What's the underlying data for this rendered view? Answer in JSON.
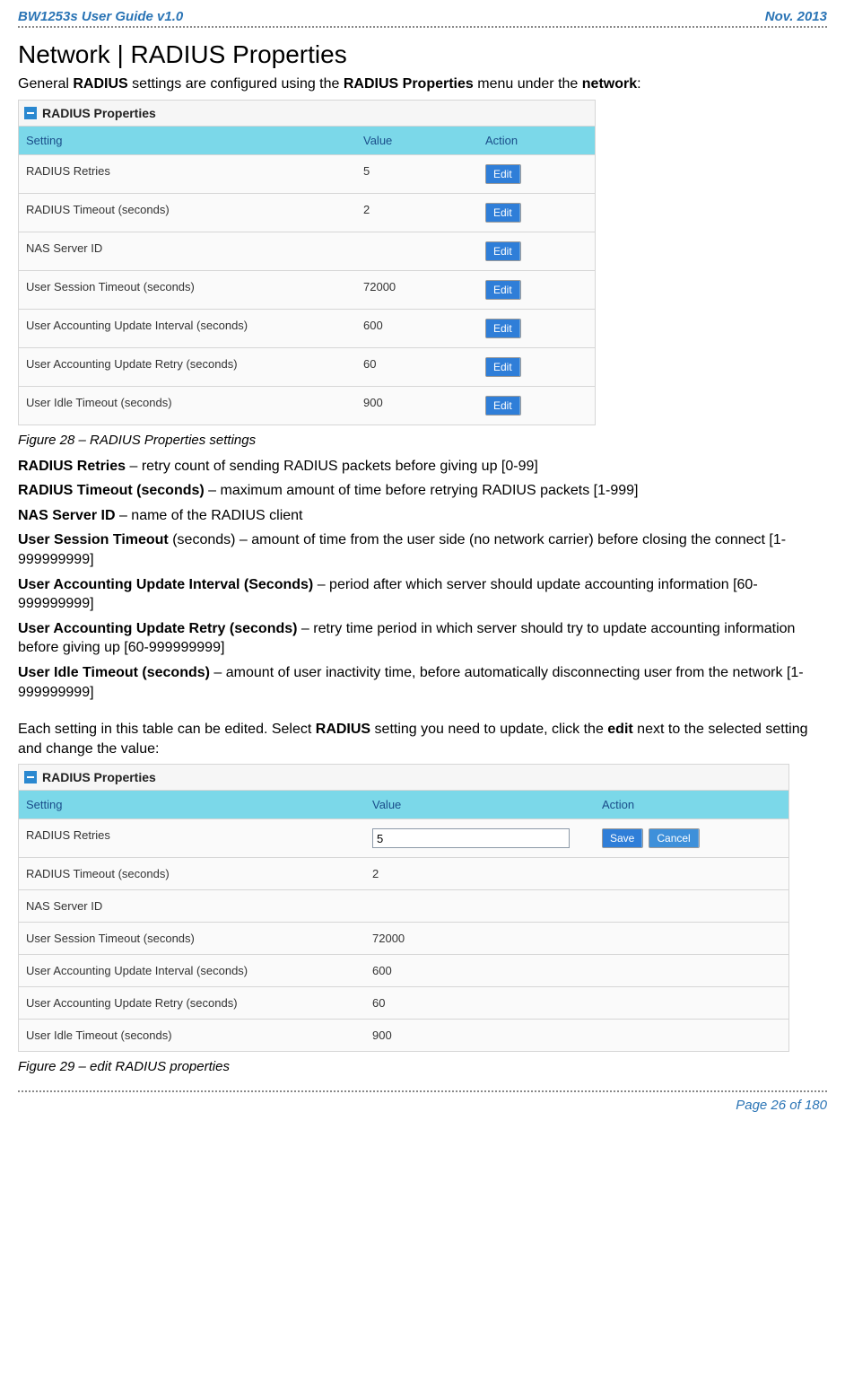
{
  "header": {
    "left": "BW1253s User Guide v1.0",
    "right": "Nov.  2013"
  },
  "title": "Network | RADIUS Properties",
  "intro": {
    "pre": "General ",
    "b1": "RADIUS",
    "mid": " settings are configured using the ",
    "b2": "RADIUS Properties",
    "mid2": " menu under the ",
    "b3": "network",
    "post": ":"
  },
  "panel_title": "RADIUS Properties",
  "columns": {
    "setting": "Setting",
    "value": "Value",
    "action": "Action"
  },
  "rows1": [
    {
      "setting": "RADIUS Retries",
      "value": "5"
    },
    {
      "setting": "RADIUS Timeout (seconds)",
      "value": "2"
    },
    {
      "setting": "NAS Server ID",
      "value": ""
    },
    {
      "setting": "User Session Timeout (seconds)",
      "value": "72000"
    },
    {
      "setting": "User Accounting Update Interval (seconds)",
      "value": "600"
    },
    {
      "setting": "User Accounting Update Retry (seconds)",
      "value": "60"
    },
    {
      "setting": "User Idle Timeout (seconds)",
      "value": "900"
    }
  ],
  "btn_edit": "Edit",
  "btn_save": "Save",
  "btn_cancel": "Cancel",
  "fig28": "Figure 28 – RADIUS Properties settings",
  "defs": [
    {
      "b": "RADIUS Retries",
      "t": " – retry count of sending RADIUS packets before giving up [0-99]"
    },
    {
      "b": "RADIUS Timeout (seconds)",
      "t": " – maximum amount of time before retrying RADIUS packets [1-999]"
    },
    {
      "b": "NAS Server ID",
      "t": " – name of the RADIUS client"
    },
    {
      "b": "User Session Timeout",
      "t": " (seconds) – amount of time from the user side (no network carrier) before closing the connect [1-999999999]"
    },
    {
      "b": "User Accounting Update Interval (Seconds)",
      "t": " – period after which server should update accounting information [60-999999999]"
    },
    {
      "b": "User Accounting Update Retry (seconds)",
      "t": " – retry time period in which server should try to update accounting information before giving up [60-999999999]"
    },
    {
      "b": "User Idle Timeout (seconds)",
      "t": " – amount of user inactivity time, before automatically disconnecting user from the network [1-999999999]"
    }
  ],
  "para_each": {
    "p1": "Each setting in this table can be edited. Select ",
    "b1": "RADIUS",
    "p2": " setting you need to update, click the ",
    "b2": "edit",
    "p3": " next to the selected setting and change the value:"
  },
  "rows2": [
    {
      "setting": "RADIUS Retries",
      "value": "5",
      "editing": true
    },
    {
      "setting": "RADIUS Timeout (seconds)",
      "value": "2"
    },
    {
      "setting": "NAS Server ID",
      "value": ""
    },
    {
      "setting": "User Session Timeout (seconds)",
      "value": "72000"
    },
    {
      "setting": "User Accounting Update Interval (seconds)",
      "value": "600"
    },
    {
      "setting": "User Accounting Update Retry (seconds)",
      "value": "60"
    },
    {
      "setting": "User Idle Timeout (seconds)",
      "value": "900"
    }
  ],
  "fig29": "Figure 29 – edit RADIUS properties",
  "footer": "Page 26 of 180"
}
